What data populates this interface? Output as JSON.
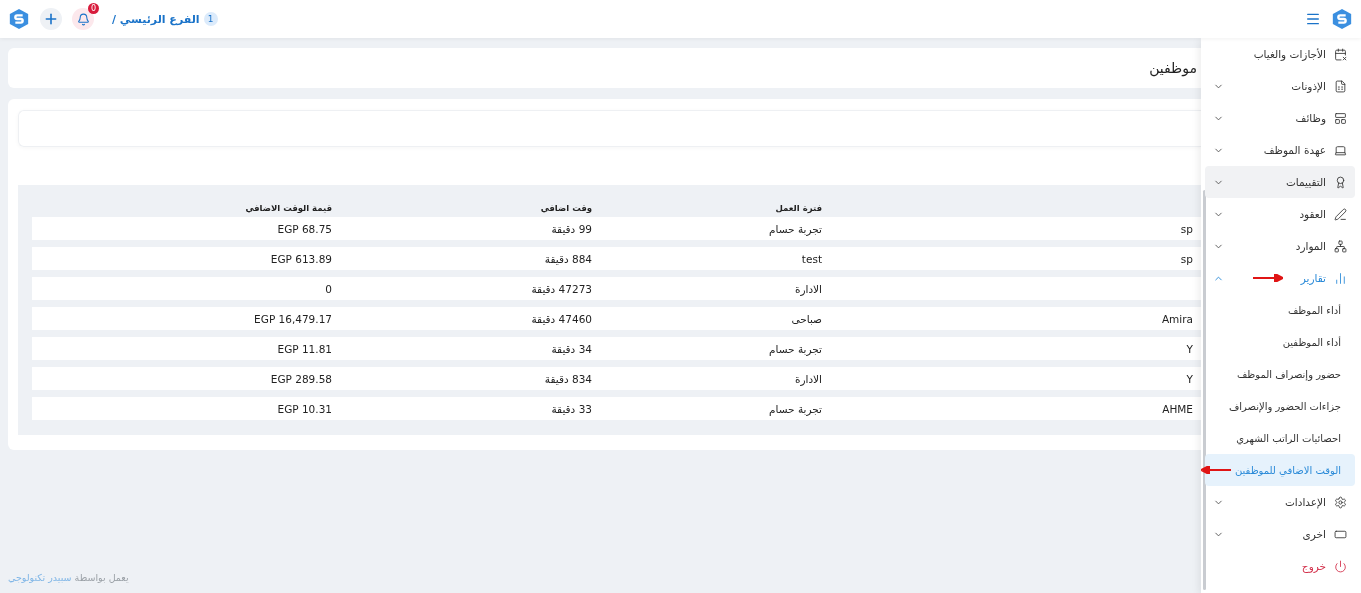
{
  "header": {
    "breadcrumb": {
      "count": "1",
      "label": "الفرع الرئيسي /"
    },
    "notifications": {
      "badge": "0"
    }
  },
  "page": {
    "title": "موظفين"
  },
  "table": {
    "columns": [
      "فترة العمل",
      "وقت اضافي",
      "قيمة الوقت الاضافي"
    ],
    "rows": [
      {
        "column_1": "sp",
        "shift": "تجربة حسام",
        "overtime": "99 دقيقة",
        "value": "EGP 68.75"
      },
      {
        "column_1": "sp",
        "shift": "test",
        "overtime": "884 دقيقة",
        "value": "EGP 613.89"
      },
      {
        "shift": "الادارة",
        "overtime": "47273 دقيقة",
        "value": "0"
      },
      {
        "column_1": "Amira",
        "shift": "صباحى",
        "overtime": "47460 دقيقة",
        "value": "EGP 16,479.17"
      },
      {
        "column_1": "Y",
        "shift": "تجربة حسام",
        "overtime": "34 دقيقة",
        "value": "EGP 11.81"
      },
      {
        "column_1": "Y",
        "shift": "الادارة",
        "overtime": "834 دقيقة",
        "value": "EGP 289.58"
      },
      {
        "column_1": "AHME",
        "shift": "تجربة حسام",
        "overtime": "33 دقيقة",
        "value": "EGP 10.31"
      }
    ]
  },
  "sidebar": {
    "items": [
      {
        "kind": "plain",
        "label": "الأجازات والغياب",
        "selected": false,
        "arrow": false
      },
      {
        "kind": "group",
        "label": "الإذونات",
        "expanded": false,
        "selected": false,
        "arrow": false
      },
      {
        "kind": "group",
        "label": "وظائف",
        "expanded": false,
        "selected": false,
        "arrow": false
      },
      {
        "kind": "group",
        "label": "عهدة الموظف",
        "expanded": false,
        "selected": false,
        "arrow": false
      },
      {
        "kind": "group",
        "label": "التقييمات",
        "expanded": false,
        "selected": true,
        "arrow": false
      },
      {
        "kind": "group",
        "label": "العقود",
        "expanded": false,
        "selected": false,
        "arrow": false
      },
      {
        "kind": "group",
        "label": "الموارد",
        "expanded": false,
        "selected": false,
        "arrow": false
      },
      {
        "kind": "group",
        "label": "تقارير",
        "expanded": true,
        "selected": false,
        "arrow": true,
        "children": [
          {
            "label": "أداء الموظف",
            "selected": false,
            "arrow": false
          },
          {
            "label": "أداء الموظفين",
            "selected": false,
            "arrow": false
          },
          {
            "label": "حضور وإنصراف الموظف",
            "selected": false,
            "arrow": false
          },
          {
            "label": "جزاءات الحضور والإنصراف",
            "selected": false,
            "arrow": false
          },
          {
            "label": "احصائيات الراتب الشهري",
            "selected": false,
            "arrow": false
          },
          {
            "label": "الوقت الاضافي للموظفين",
            "selected": true,
            "arrow": true
          }
        ]
      },
      {
        "kind": "group",
        "label": "الإعدادات",
        "expanded": false,
        "selected": false,
        "arrow": false
      },
      {
        "kind": "group",
        "label": "اخرى",
        "expanded": false,
        "selected": false,
        "arrow": false
      },
      {
        "kind": "logout",
        "label": "خروج",
        "selected": false,
        "arrow": false
      }
    ]
  },
  "footer": {
    "text": "يعمل بواسطة",
    "link": "سبيدر تكنولوجي"
  }
}
